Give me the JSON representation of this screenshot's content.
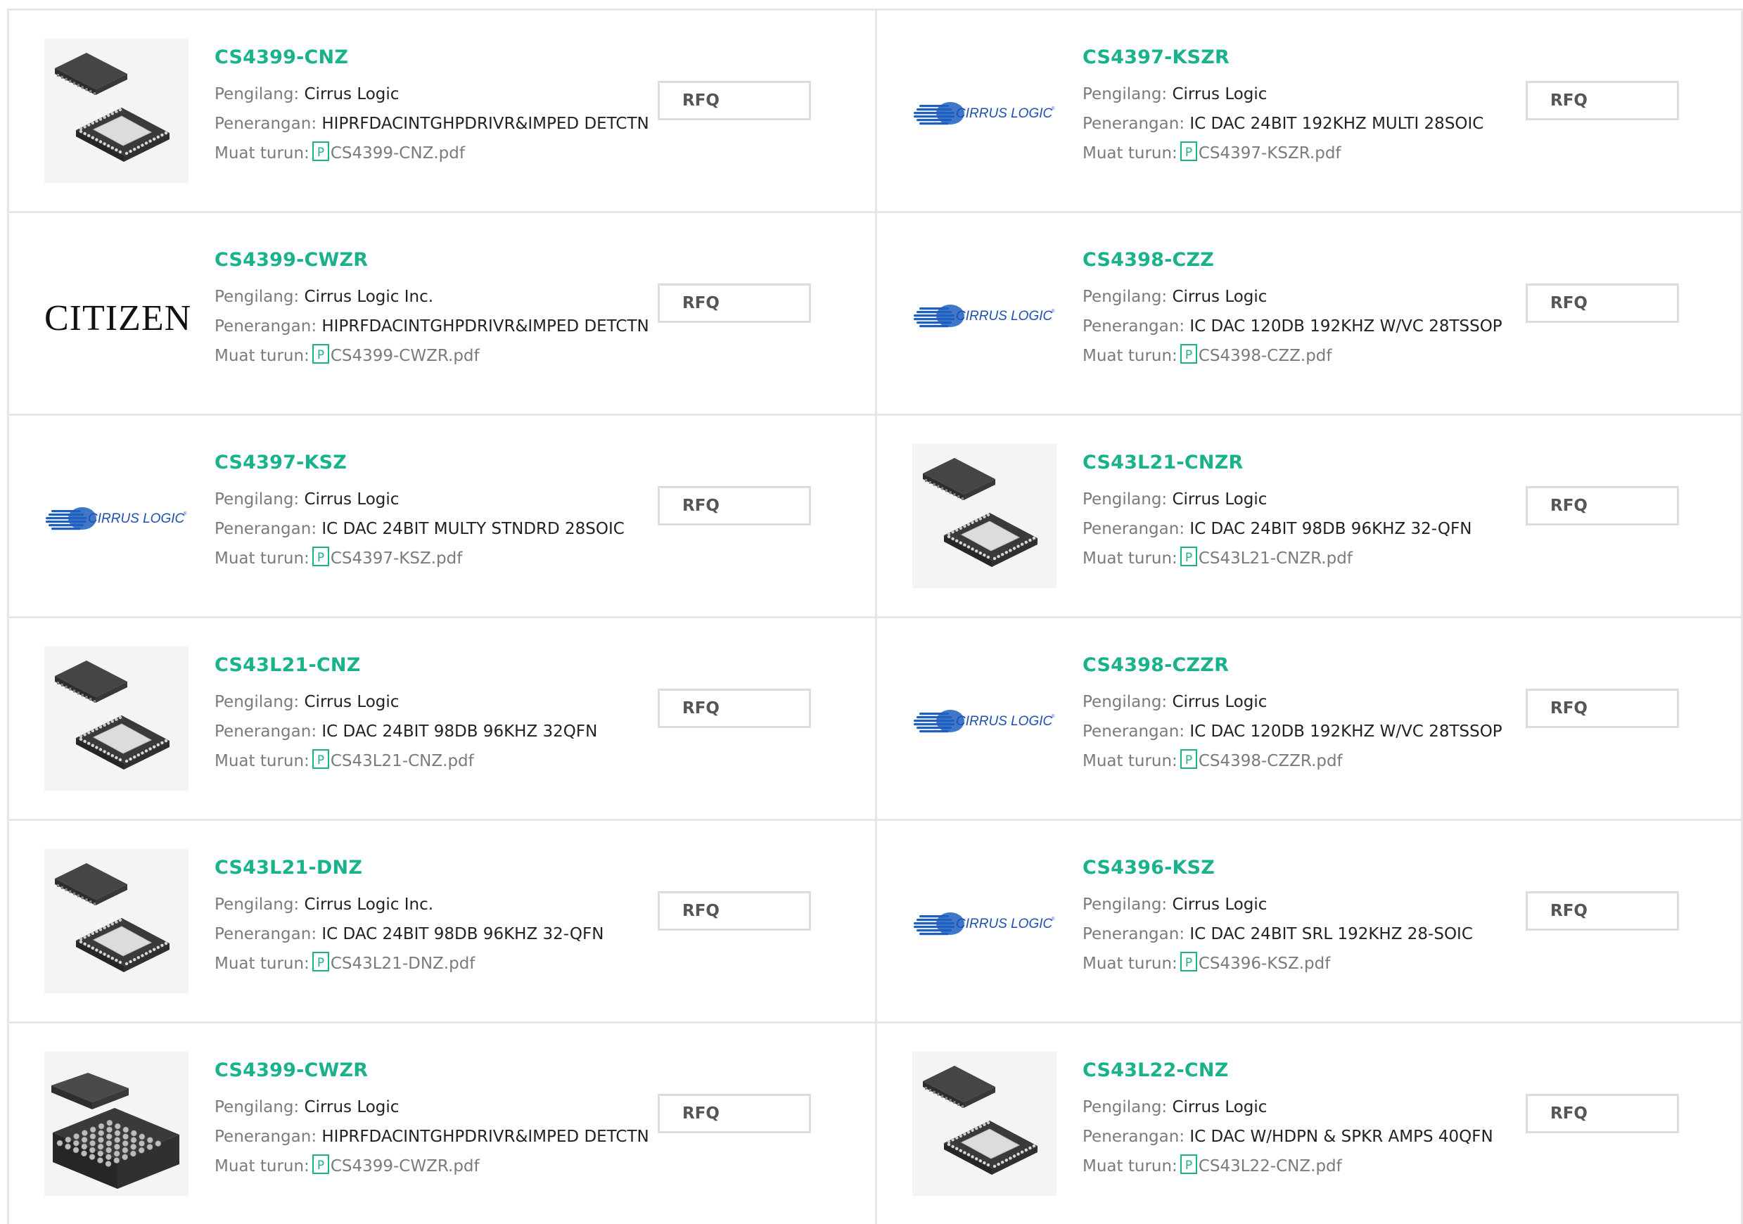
{
  "labels": {
    "manufacturer": "Pengilang:",
    "description": "Penerangan:",
    "download": "Muat turun:",
    "rfq": "RFQ"
  },
  "colors": {
    "accent": "#19b28a",
    "label": "#7b7b7b",
    "border": "#e6e6e6"
  },
  "products": [
    {
      "part": "CS4399-CNZ",
      "manufacturer": "Cirrus Logic",
      "description": "HIPRFDACINTGHPDRIVR&IMPED DETCTN",
      "file": "CS4399-CNZ.pdf",
      "image": "qfn-chip-icon"
    },
    {
      "part": "CS4397-KSZR",
      "manufacturer": "Cirrus Logic",
      "description": "IC DAC 24BIT 192KHZ MULTI 28SOIC",
      "file": "CS4397-KSZR.pdf",
      "image": "cirrus-logic-logo"
    },
    {
      "part": "CS4399-CWZR",
      "manufacturer": "Cirrus Logic Inc.",
      "description": "HIPRFDACINTGHPDRIVR&IMPED DETCTN",
      "file": "CS4399-CWZR.pdf",
      "image": "citizen-logo",
      "logo_text": "CITIZEN"
    },
    {
      "part": "CS4398-CZZ",
      "manufacturer": "Cirrus Logic",
      "description": "IC DAC 120DB 192KHZ W/VC 28TSSOP",
      "file": "CS4398-CZZ.pdf",
      "image": "cirrus-logic-logo"
    },
    {
      "part": "CS4397-KSZ",
      "manufacturer": "Cirrus Logic",
      "description": "IC DAC 24BIT MULTY STNDRD 28SOIC",
      "file": "CS4397-KSZ.pdf",
      "image": "cirrus-logic-logo"
    },
    {
      "part": "CS43L21-CNZR",
      "manufacturer": "Cirrus Logic",
      "description": "IC DAC 24BIT 98DB 96KHZ 32-QFN",
      "file": "CS43L21-CNZR.pdf",
      "image": "qfn-chip-icon"
    },
    {
      "part": "CS43L21-CNZ",
      "manufacturer": "Cirrus Logic",
      "description": "IC DAC 24BIT 98DB 96KHZ 32QFN",
      "file": "CS43L21-CNZ.pdf",
      "image": "qfn-chip-icon"
    },
    {
      "part": "CS4398-CZZR",
      "manufacturer": "Cirrus Logic",
      "description": "IC DAC 120DB 192KHZ W/VC 28TSSOP",
      "file": "CS4398-CZZR.pdf",
      "image": "cirrus-logic-logo"
    },
    {
      "part": "CS43L21-DNZ",
      "manufacturer": "Cirrus Logic Inc.",
      "description": "IC DAC 24BIT 98DB 96KHZ 32-QFN",
      "file": "CS43L21-DNZ.pdf",
      "image": "qfn-chip-icon"
    },
    {
      "part": "CS4396-KSZ",
      "manufacturer": "Cirrus Logic",
      "description": "IC DAC 24BIT SRL 192KHZ 28-SOIC",
      "file": "CS4396-KSZ.pdf",
      "image": "cirrus-logic-logo"
    },
    {
      "part": "CS4399-CWZR",
      "manufacturer": "Cirrus Logic",
      "description": "HIPRFDACINTGHPDRIVR&IMPED DETCTN",
      "file": "CS4399-CWZR.pdf",
      "image": "bga-chip-icon"
    },
    {
      "part": "CS43L22-CNZ",
      "manufacturer": "Cirrus Logic",
      "description": "IC DAC W/HDPN & SPKR AMPS 40QFN",
      "file": "CS43L22-CNZ.pdf",
      "image": "qfn-chip-icon"
    }
  ]
}
